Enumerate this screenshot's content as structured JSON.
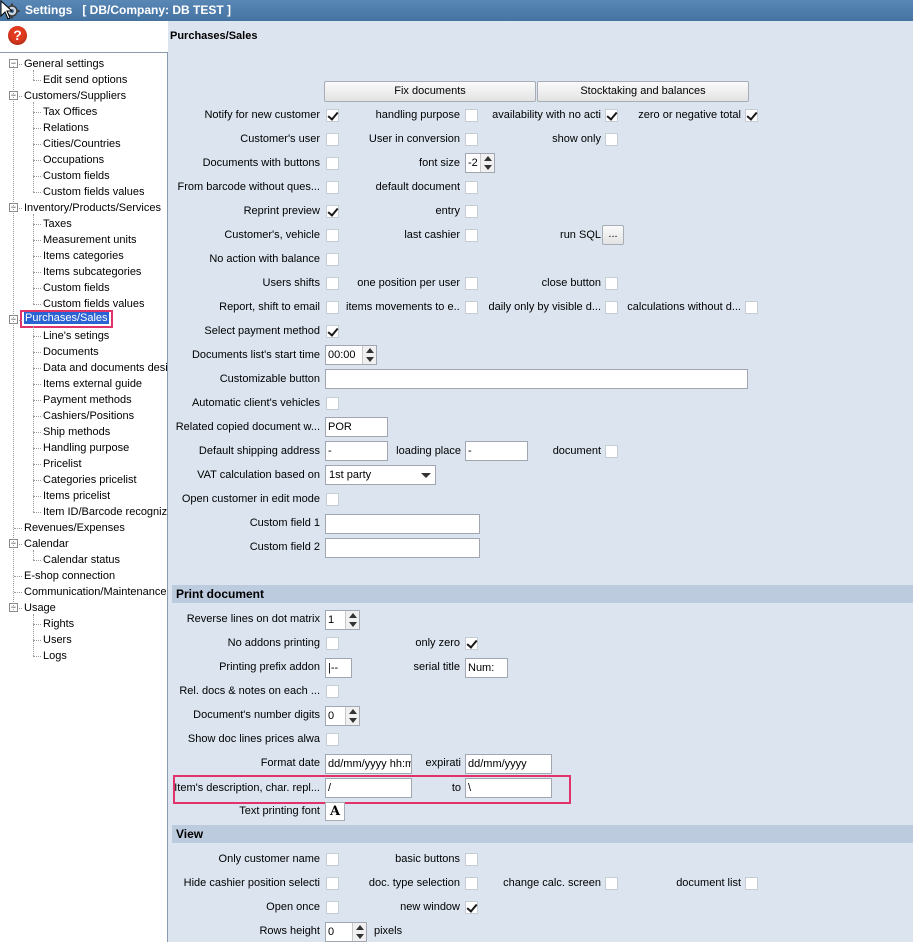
{
  "window": {
    "title": "Settings   [ DB/Company: DB TEST ]"
  },
  "help": {
    "label": "?"
  },
  "page_title": "Purchases/Sales",
  "tree": {
    "items": [
      {
        "label": "General settings",
        "level": 0
      },
      {
        "label": "Edit send options",
        "level": 1
      },
      {
        "label": "Customers/Suppliers",
        "level": 0
      },
      {
        "label": "Tax Offices",
        "level": 1
      },
      {
        "label": "Relations",
        "level": 1
      },
      {
        "label": "Cities/Countries",
        "level": 1
      },
      {
        "label": "Occupations",
        "level": 1
      },
      {
        "label": "Custom fields",
        "level": 1
      },
      {
        "label": "Custom fields values",
        "level": 1
      },
      {
        "label": "Inventory/Products/Services",
        "level": 0
      },
      {
        "label": "Taxes",
        "level": 1
      },
      {
        "label": "Measurement units",
        "level": 1
      },
      {
        "label": "Items categories",
        "level": 1
      },
      {
        "label": "Items subcategories",
        "level": 1
      },
      {
        "label": "Custom fields",
        "level": 1
      },
      {
        "label": "Custom fields values",
        "level": 1
      },
      {
        "label": "Purchases/Sales",
        "level": 0
      },
      {
        "label": "Line's setings",
        "level": 1
      },
      {
        "label": "Documents",
        "level": 1
      },
      {
        "label": "Data and documents desi",
        "level": 1
      },
      {
        "label": "Items external guide",
        "level": 1
      },
      {
        "label": "Payment methods",
        "level": 1
      },
      {
        "label": "Cashiers/Positions",
        "level": 1
      },
      {
        "label": "Ship methods",
        "level": 1
      },
      {
        "label": "Handling purpose",
        "level": 1
      },
      {
        "label": "Pricelist",
        "level": 1
      },
      {
        "label": "Categories pricelist",
        "level": 1
      },
      {
        "label": "Items pricelist",
        "level": 1
      },
      {
        "label": "Item ID/Barcode recognize",
        "level": 1
      },
      {
        "label": "Revenues/Expenses",
        "level": 0
      },
      {
        "label": "Calendar",
        "level": 0
      },
      {
        "label": "Calendar status",
        "level": 1
      },
      {
        "label": "E-shop connection",
        "level": 0
      },
      {
        "label": "Communication/Maintenance",
        "level": 0
      },
      {
        "label": "Usage",
        "level": 0
      },
      {
        "label": "Rights",
        "level": 1
      },
      {
        "label": "Users",
        "level": 1
      },
      {
        "label": "Logs",
        "level": 1
      }
    ]
  },
  "buttons": {
    "fix_documents": "Fix documents",
    "stocktaking": "Stocktaking and balances",
    "run_sql": "..."
  },
  "labels": {
    "notify_new_customer": "Notify for new customer",
    "handling_purpose": "handling purpose",
    "availability_no_acti": "availability with no acti",
    "zero_negative_total": "zero or negative total",
    "customers_user": "Customer's user",
    "user_in_conversion": "User in conversion",
    "show_only": "show only",
    "documents_with_buttons": "Documents with buttons",
    "font_size": "font size",
    "from_barcode": "From barcode without ques...",
    "default_document": "default document",
    "reprint_preview": "Reprint preview",
    "entry": "entry",
    "customers_vehicle": "Customer's, vehicle",
    "last_cashier": "last cashier",
    "run_sql": "run SQL",
    "no_action_balance": "No action with balance",
    "users_shifts": "Users shifts",
    "one_position_per_user": "one position per user",
    "close_button": "close button",
    "report_shift_email": "Report, shift to email",
    "items_movements": "items movements to e...",
    "daily_only_visible": "daily only by visible d...",
    "calculations_without": "calculations without d...",
    "select_payment_method": "Select payment method",
    "doc_list_start_time": "Documents list's start time",
    "customizable_button": "Customizable button",
    "automatic_client_vehicles": "Automatic client's vehicles",
    "related_copied_doc": "Related copied document w...",
    "default_shipping_address": "Default shipping address",
    "loading_place": "loading place",
    "document": "document",
    "vat_calc": "VAT calculation based on",
    "open_customer_edit": "Open customer in edit mode",
    "custom_field_1": "Custom field 1",
    "custom_field_2": "Custom field 2",
    "reverse_lines": "Reverse lines on dot matrix",
    "no_addons_printing": "No addons printing",
    "only_zero": "only zero",
    "printing_prefix_addon": "Printing prefix addon",
    "serial_title": "serial title",
    "rel_docs_notes": "Rel. docs & notes on each ...",
    "documents_number_digits": "Document's number digits",
    "show_doc_lines_prices": "Show doc lines prices alwa",
    "format_date": "Format date",
    "expirati": "expirati",
    "items_desc_char_repl": "Item's description, char. repl...",
    "to": "to",
    "text_printing_font": "Text printing font",
    "only_customer_name": "Only customer name",
    "basic_buttons": "basic buttons",
    "hide_cashier_position": "Hide cashier position selecti",
    "doc_type_selection": "doc. type selection",
    "change_calc_screen": "change calc. screen",
    "document_list": "document list",
    "open_once": "Open once",
    "new_window": "new window",
    "rows_height": "Rows height",
    "pixels": "pixels"
  },
  "sections": {
    "print_document": "Print document",
    "view": "View"
  },
  "values": {
    "font_size": "-2",
    "start_time": "00:00",
    "customizable_button": "",
    "related_copied_doc": "POR",
    "default_shipping_address": "-",
    "loading_place": "-",
    "vat_calc": "1st party",
    "custom_field_1": "",
    "custom_field_2": "",
    "reverse_lines": "1",
    "printing_prefix_addon": "|--",
    "serial_title": "Num:",
    "documents_number_digits": "0",
    "format_date": "dd/mm/yyyy hh:mm",
    "expirati": "dd/mm/yyyy",
    "char_repl_from": "/",
    "char_repl_to": "\\",
    "font_icon": "A",
    "rows_height": "0"
  }
}
